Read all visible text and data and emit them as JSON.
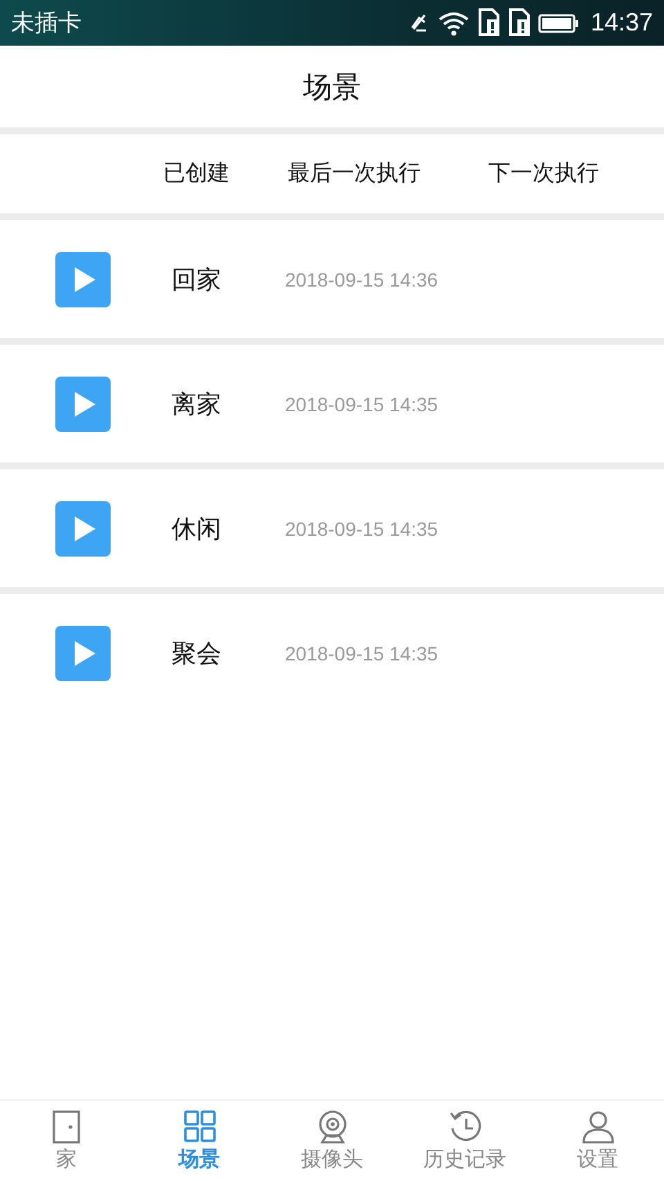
{
  "status_bar": {
    "carrier": "未插卡",
    "time": "14:37"
  },
  "header": {
    "title": "场景"
  },
  "columns": [
    "已创建",
    "最后一次执行",
    "下一次执行"
  ],
  "scenes": [
    {
      "name": "回家",
      "last_run": "2018-09-15 14:36"
    },
    {
      "name": "离家",
      "last_run": "2018-09-15 14:35"
    },
    {
      "name": "休闲",
      "last_run": "2018-09-15 14:35"
    },
    {
      "name": "聚会",
      "last_run": "2018-09-15 14:35"
    }
  ],
  "nav": [
    {
      "kind": "door",
      "label": "家",
      "selected": false
    },
    {
      "kind": "grid",
      "label": "场景",
      "selected": true
    },
    {
      "kind": "camera",
      "label": "摄像头",
      "selected": false
    },
    {
      "kind": "history",
      "label": "历史记录",
      "selected": false
    },
    {
      "kind": "person",
      "label": "设置",
      "selected": false
    }
  ]
}
